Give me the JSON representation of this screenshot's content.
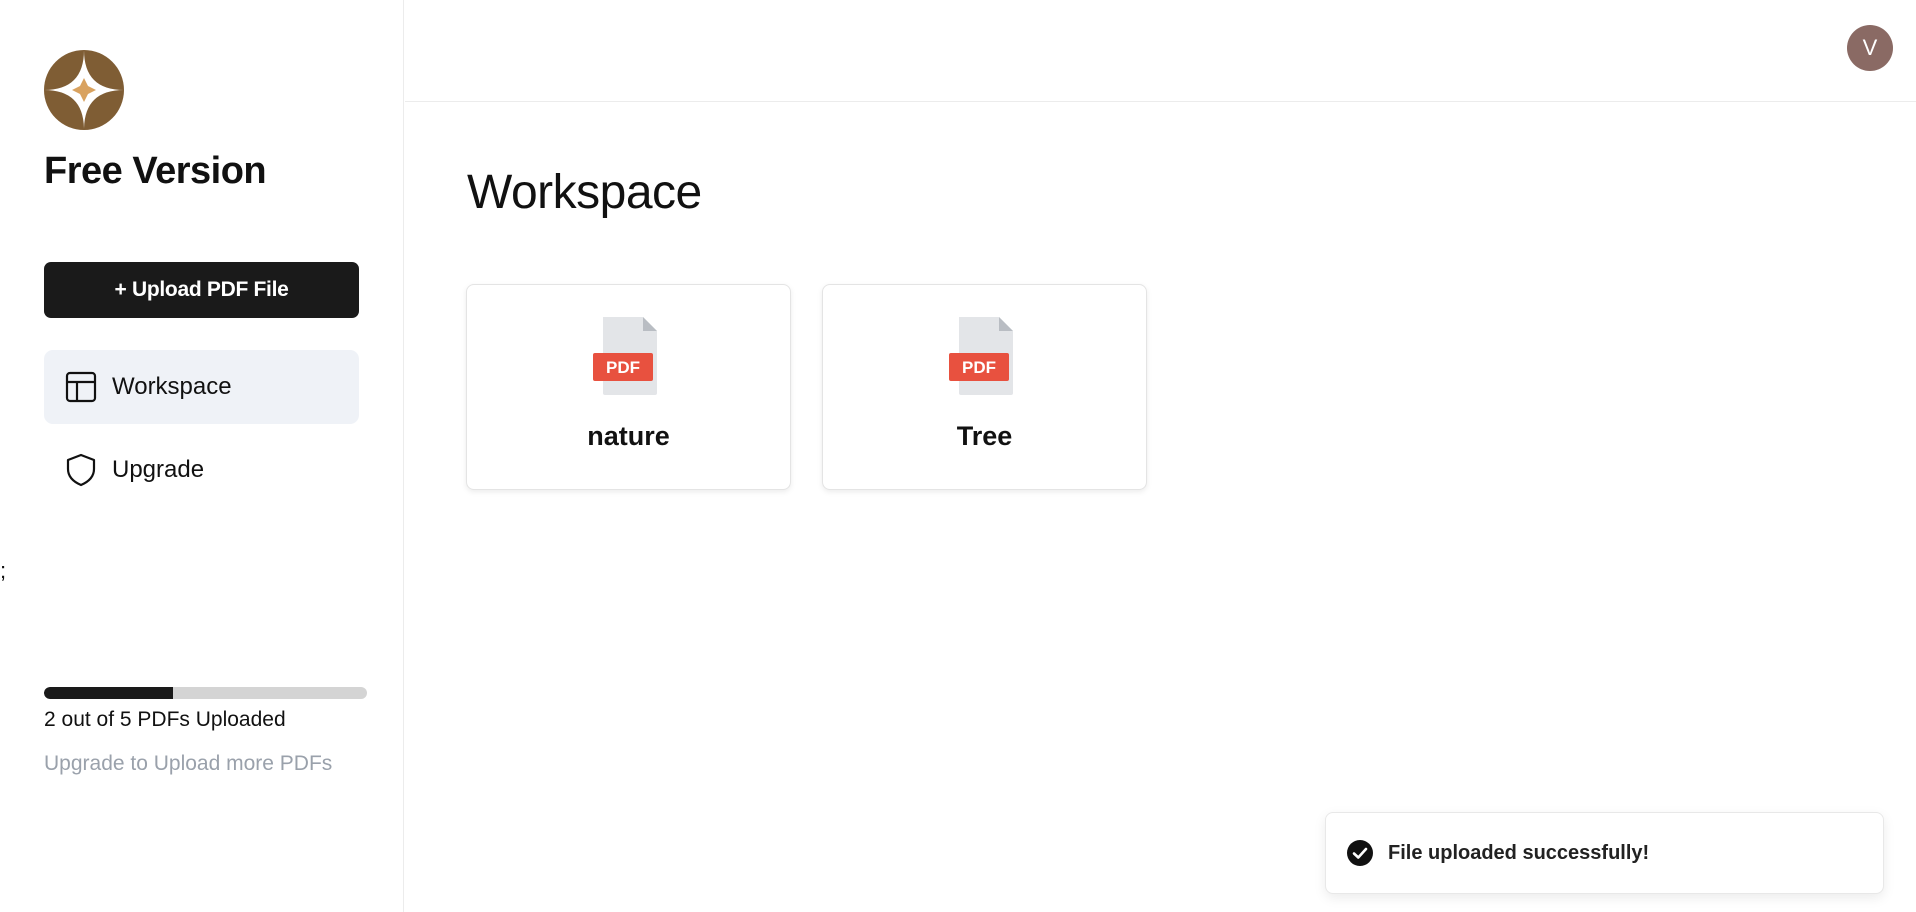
{
  "sidebar": {
    "logo_icon": "compass-star-logo",
    "plan_title": "Free Version",
    "upload_button_label": "+ Upload PDF File",
    "nav": [
      {
        "label": "Workspace",
        "icon": "layout-icon",
        "active": true
      },
      {
        "label": "Upgrade",
        "icon": "shield-icon",
        "active": false
      }
    ],
    "stray_text": ";",
    "usage": {
      "uploaded": 2,
      "limit": 5,
      "progress_fraction": 0.4,
      "text": "2 out of 5 PDFs Uploaded",
      "upgrade_hint": "Upgrade to Upload more PDFs"
    }
  },
  "header": {
    "avatar_initial": "V",
    "avatar_color": "#8a6a64"
  },
  "main": {
    "title": "Workspace",
    "files": [
      {
        "name": "nature",
        "icon": "pdf-file-icon",
        "badge": "PDF"
      },
      {
        "name": "Tree",
        "icon": "pdf-file-icon",
        "badge": "PDF"
      }
    ]
  },
  "toast": {
    "icon": "check-circle-icon",
    "message": "File uploaded successfully!"
  },
  "colors": {
    "brand_brown": "#7f5d34",
    "brand_gold": "#d9a25f",
    "primary_dark": "#1a1a1a",
    "pdf_red": "#e8513f",
    "active_nav_bg": "#eff2f7"
  }
}
